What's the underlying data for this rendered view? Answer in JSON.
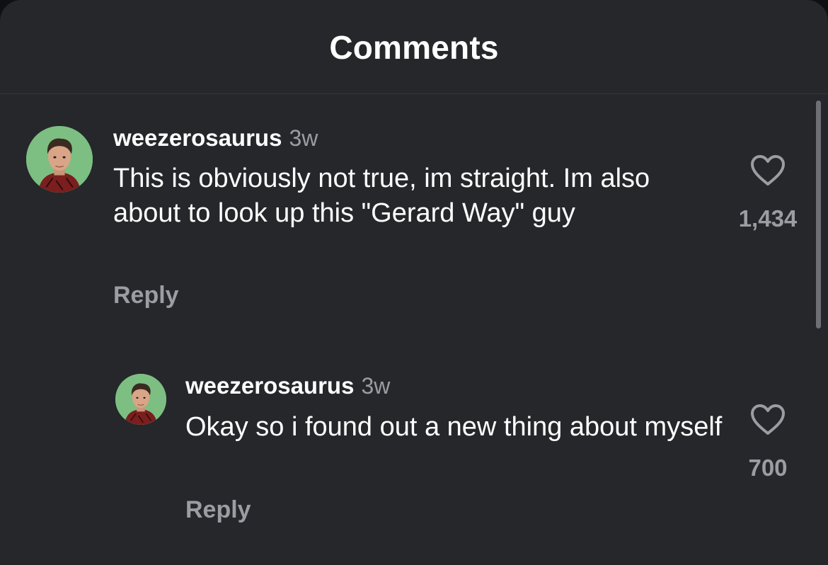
{
  "header": {
    "title": "Comments"
  },
  "comments": [
    {
      "username": "weezerosaurus",
      "time": "3w",
      "text": "This is obviously not true, im straight. Im also about to look up this \"Gerard Way\" guy",
      "reply_label": "Reply",
      "likes": "1,434",
      "avatar_icon": "profile-photo",
      "like_icon": "heart-outline-icon"
    },
    {
      "username": "weezerosaurus",
      "time": "3w",
      "text": "Okay so i found out a new thing about myself",
      "reply_label": "Reply",
      "likes": "700",
      "avatar_icon": "profile-photo",
      "like_icon": "heart-outline-icon"
    }
  ],
  "colors": {
    "background": "#25272b",
    "text_primary": "#ffffff",
    "text_secondary": "#9b9da2",
    "avatar_bg": "#7dbf82"
  }
}
